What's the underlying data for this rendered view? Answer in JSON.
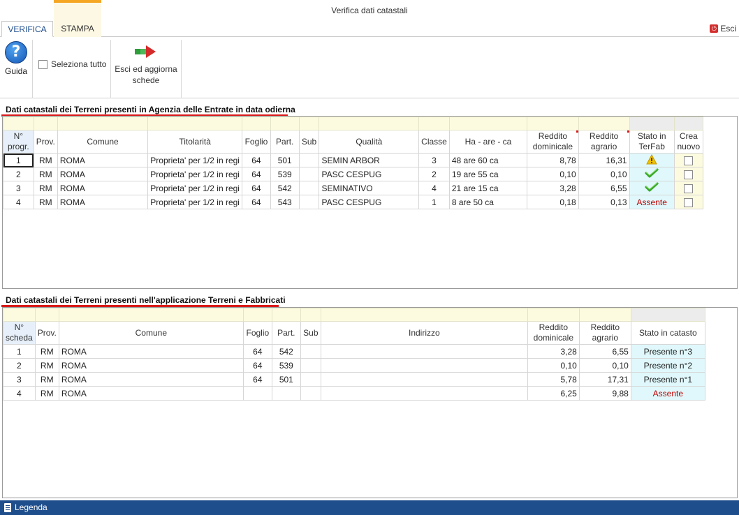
{
  "window": {
    "title": "Verifica dati catastali"
  },
  "tabs": [
    {
      "label": "VERIFICA",
      "active": true
    },
    {
      "label": "STAMPA",
      "active": false
    }
  ],
  "esci_top": {
    "label": "Esci"
  },
  "ribbon": {
    "guida": "Guida",
    "seleziona_tutto": "Seleziona tutto",
    "esci_aggiorna_line1": "Esci ed aggiorna",
    "esci_aggiorna_line2": "schede"
  },
  "section1": {
    "title": "Dati catastali dei Terreni presenti in Agenzia delle Entrate in data odierna",
    "headers": {
      "nprogr_1": "N°",
      "nprogr_2": "progr.",
      "prov": "Prov.",
      "comune": "Comune",
      "titolarita": "Titolarità",
      "foglio": "Foglio",
      "part": "Part.",
      "sub": "Sub",
      "qualita": "Qualità",
      "classe": "Classe",
      "ha": "Ha - are - ca",
      "rd_1": "Reddito",
      "rd_2": "dominicale",
      "ra_1": "Reddito",
      "ra_2": "agrario",
      "stato_1": "Stato in",
      "stato_2": "TerFab",
      "crea_1": "Crea",
      "crea_2": "nuovo"
    },
    "rows": [
      {
        "n": "1",
        "prov": "RM",
        "comune": "ROMA",
        "titolarita": "Proprieta' per 1/2 in regi",
        "foglio": "64",
        "part": "501",
        "sub": "",
        "qualita": "SEMIN ARBOR",
        "classe": "3",
        "ha": "48 are 60 ca",
        "rd": "8,78",
        "ra": "16,31",
        "stato": "warning",
        "stato_text": ""
      },
      {
        "n": "2",
        "prov": "RM",
        "comune": "ROMA",
        "titolarita": "Proprieta' per 1/2 in regi",
        "foglio": "64",
        "part": "539",
        "sub": "",
        "qualita": "PASC CESPUG",
        "classe": "2",
        "ha": "19 are 55 ca",
        "rd": "0,10",
        "ra": "0,10",
        "stato": "ok",
        "stato_text": ""
      },
      {
        "n": "3",
        "prov": "RM",
        "comune": "ROMA",
        "titolarita": "Proprieta' per 1/2 in regi",
        "foglio": "64",
        "part": "542",
        "sub": "",
        "qualita": "SEMINATIVO",
        "classe": "4",
        "ha": "21 are 15 ca",
        "rd": "3,28",
        "ra": "6,55",
        "stato": "ok",
        "stato_text": ""
      },
      {
        "n": "4",
        "prov": "RM",
        "comune": "ROMA",
        "titolarita": "Proprieta' per 1/2 in regi",
        "foglio": "64",
        "part": "543",
        "sub": "",
        "qualita": "PASC CESPUG",
        "classe": "1",
        "ha": "8 are 50 ca",
        "rd": "0,18",
        "ra": "0,13",
        "stato": "text",
        "stato_text": "Assente"
      }
    ]
  },
  "section2": {
    "title": "Dati catastali dei Terreni presenti nell'applicazione Terreni e Fabbricati",
    "headers": {
      "nscheda_1": "N°",
      "nscheda_2": "scheda",
      "prov": "Prov.",
      "comune": "Comune",
      "foglio": "Foglio",
      "part": "Part.",
      "sub": "Sub",
      "indirizzo": "Indirizzo",
      "rd_1": "Reddito",
      "rd_2": "dominicale",
      "ra_1": "Reddito",
      "ra_2": "agrario",
      "stato": "Stato in catasto"
    },
    "rows": [
      {
        "n": "1",
        "prov": "RM",
        "comune": "ROMA",
        "foglio": "64",
        "part": "542",
        "sub": "",
        "indirizzo": "",
        "rd": "3,28",
        "ra": "6,55",
        "stato": "Presente n°3"
      },
      {
        "n": "2",
        "prov": "RM",
        "comune": "ROMA",
        "foglio": "64",
        "part": "539",
        "sub": "",
        "indirizzo": "",
        "rd": "0,10",
        "ra": "0,10",
        "stato": "Presente n°2"
      },
      {
        "n": "3",
        "prov": "RM",
        "comune": "ROMA",
        "foglio": "64",
        "part": "501",
        "sub": "",
        "indirizzo": "",
        "rd": "5,78",
        "ra": "17,31",
        "stato": "Presente n°1"
      },
      {
        "n": "4",
        "prov": "RM",
        "comune": "ROMA",
        "foglio": "",
        "part": "",
        "sub": "",
        "indirizzo": "",
        "rd": "6,25",
        "ra": "9,88",
        "stato": "Assente"
      }
    ]
  },
  "footer": {
    "legenda": "Legenda"
  },
  "colors": {
    "accent": "#1f4e8c",
    "stampa_tab": "#f5a623",
    "underline": "#d91a1a",
    "assente": "#c00000",
    "ok": "#3aa82a",
    "warning": "#f2c200"
  }
}
